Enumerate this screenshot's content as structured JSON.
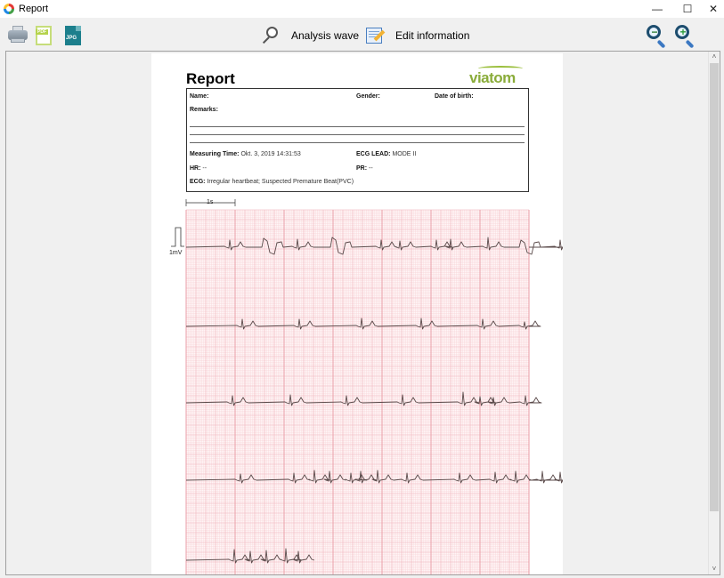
{
  "window": {
    "title": "Report",
    "controls": {
      "minimize": "—",
      "maximize": "☐",
      "close": "✕"
    }
  },
  "toolbar": {
    "print_icon": "printer",
    "pdf_label": "PDF",
    "jpg_label": "JPG",
    "analysis_wave_label": "Analysis wave",
    "edit_information_label": "Edit information",
    "zoom_out_symbol": "−",
    "zoom_in_symbol": "+"
  },
  "report": {
    "title": "Report",
    "logo": "viatom",
    "fields": {
      "name_label": "Name:",
      "gender_label": "Gender:",
      "dob_label": "Date of birth:",
      "remarks_label": "Remarks:",
      "measuring_time_label": "Measuring Time:",
      "measuring_time_value": " Okt. 3, 2019 14:31:53",
      "ecg_lead_label": "ECG LEAD:",
      "ecg_lead_value": " MODE II",
      "hr_label": "HR:",
      "hr_value": " --",
      "pr_label": "PR:",
      "pr_value": " --",
      "ecg_label": "ECG:",
      "ecg_value": " Irregular heartbeat; Suspected Premature Beat(PVC)"
    },
    "strip": {
      "time_scale_label": "1s",
      "amplitude_scale_label": "1mV",
      "grid_color_minor": "#f7d4d8",
      "grid_color_major": "#e89aa3",
      "trace_color": "#5a4a4a"
    }
  },
  "scrollbar": {
    "up": "˄",
    "down": "˅"
  }
}
